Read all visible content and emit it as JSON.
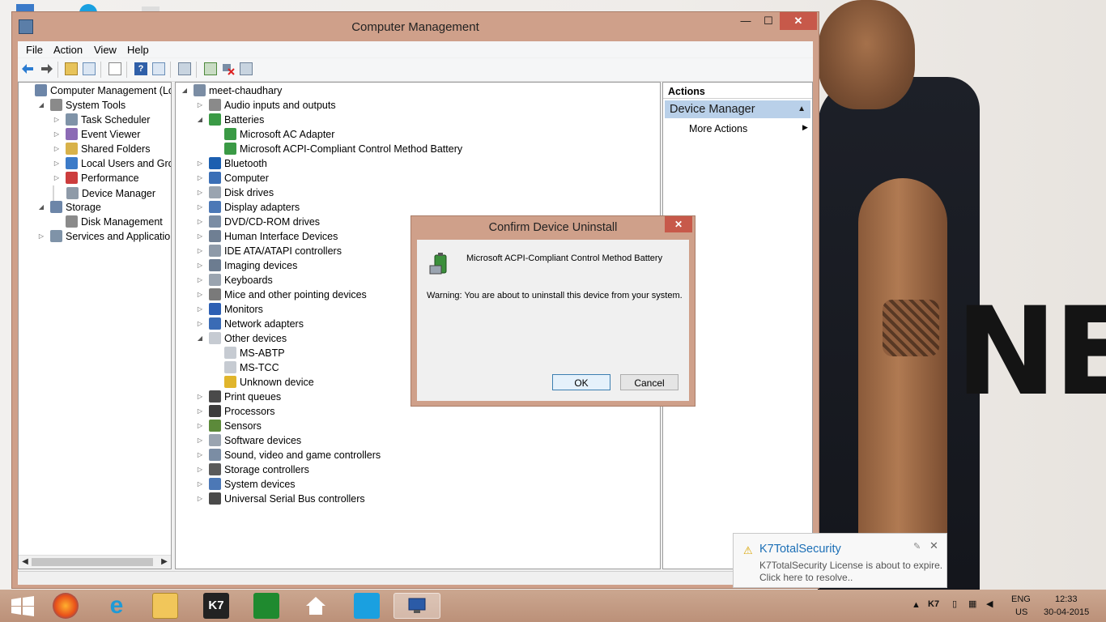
{
  "window": {
    "title": "Computer Management"
  },
  "menu": [
    "File",
    "Action",
    "View",
    "Help"
  ],
  "left_tree": [
    {
      "label": "Computer Management (Local",
      "expander": "",
      "indent": 0
    },
    {
      "label": "System Tools",
      "expander": "◢",
      "indent": 1
    },
    {
      "label": "Task Scheduler",
      "expander": "▷",
      "indent": 2
    },
    {
      "label": "Event Viewer",
      "expander": "▷",
      "indent": 2
    },
    {
      "label": "Shared Folders",
      "expander": "▷",
      "indent": 2
    },
    {
      "label": "Local Users and Groups",
      "expander": "▷",
      "indent": 2
    },
    {
      "label": "Performance",
      "expander": "▷",
      "indent": 2
    },
    {
      "label": "Device Manager",
      "expander": "",
      "indent": 2,
      "selected": true
    },
    {
      "label": "Storage",
      "expander": "◢",
      "indent": 1
    },
    {
      "label": "Disk Management",
      "expander": "",
      "indent": 2
    },
    {
      "label": "Services and Applications",
      "expander": "▷",
      "indent": 1
    }
  ],
  "device_tree": [
    {
      "label": "meet-chaudhary",
      "expander": "◢",
      "indent": 0
    },
    {
      "label": "Audio inputs and outputs",
      "expander": "▷",
      "indent": 1
    },
    {
      "label": "Batteries",
      "expander": "◢",
      "indent": 1
    },
    {
      "label": "Microsoft AC Adapter",
      "expander": "",
      "indent": 2
    },
    {
      "label": "Microsoft ACPI-Compliant Control Method Battery",
      "expander": "",
      "indent": 2
    },
    {
      "label": "Bluetooth",
      "expander": "▷",
      "indent": 1
    },
    {
      "label": "Computer",
      "expander": "▷",
      "indent": 1
    },
    {
      "label": "Disk drives",
      "expander": "▷",
      "indent": 1
    },
    {
      "label": "Display adapters",
      "expander": "▷",
      "indent": 1
    },
    {
      "label": "DVD/CD-ROM drives",
      "expander": "▷",
      "indent": 1
    },
    {
      "label": "Human Interface Devices",
      "expander": "▷",
      "indent": 1
    },
    {
      "label": "IDE ATA/ATAPI controllers",
      "expander": "▷",
      "indent": 1
    },
    {
      "label": "Imaging devices",
      "expander": "▷",
      "indent": 1
    },
    {
      "label": "Keyboards",
      "expander": "▷",
      "indent": 1
    },
    {
      "label": "Mice and other pointing devices",
      "expander": "▷",
      "indent": 1
    },
    {
      "label": "Monitors",
      "expander": "▷",
      "indent": 1
    },
    {
      "label": "Network adapters",
      "expander": "▷",
      "indent": 1
    },
    {
      "label": "Other devices",
      "expander": "◢",
      "indent": 1
    },
    {
      "label": "MS-ABTP",
      "expander": "",
      "indent": 2
    },
    {
      "label": "MS-TCC",
      "expander": "",
      "indent": 2
    },
    {
      "label": "Unknown device",
      "expander": "",
      "indent": 2
    },
    {
      "label": "Print queues",
      "expander": "▷",
      "indent": 1
    },
    {
      "label": "Processors",
      "expander": "▷",
      "indent": 1
    },
    {
      "label": "Sensors",
      "expander": "▷",
      "indent": 1
    },
    {
      "label": "Software devices",
      "expander": "▷",
      "indent": 1
    },
    {
      "label": "Sound, video and game controllers",
      "expander": "▷",
      "indent": 1
    },
    {
      "label": "Storage controllers",
      "expander": "▷",
      "indent": 1
    },
    {
      "label": "System devices",
      "expander": "▷",
      "indent": 1
    },
    {
      "label": "Universal Serial Bus controllers",
      "expander": "▷",
      "indent": 1
    }
  ],
  "actions": {
    "header": "Actions",
    "section": "Device Manager",
    "more": "More Actions"
  },
  "dialog": {
    "title": "Confirm Device Uninstall",
    "device": "Microsoft ACPI-Compliant Control Method Battery",
    "warning": "Warning: You are about to uninstall this device from your system.",
    "ok": "OK",
    "cancel": "Cancel"
  },
  "toast": {
    "title": "K7TotalSecurity",
    "line1": "K7TotalSecurity License is about to expire.",
    "line2": "Click here to resolve.."
  },
  "taskbar": {
    "lang": "ENG",
    "region": "US",
    "time": "12:33",
    "date": "30-04-2015",
    "k7_label": "K7"
  },
  "colors": {
    "window_frame": "#cfa08a",
    "close_red": "#c7594a",
    "selection_blue": "#b9d0e9"
  }
}
